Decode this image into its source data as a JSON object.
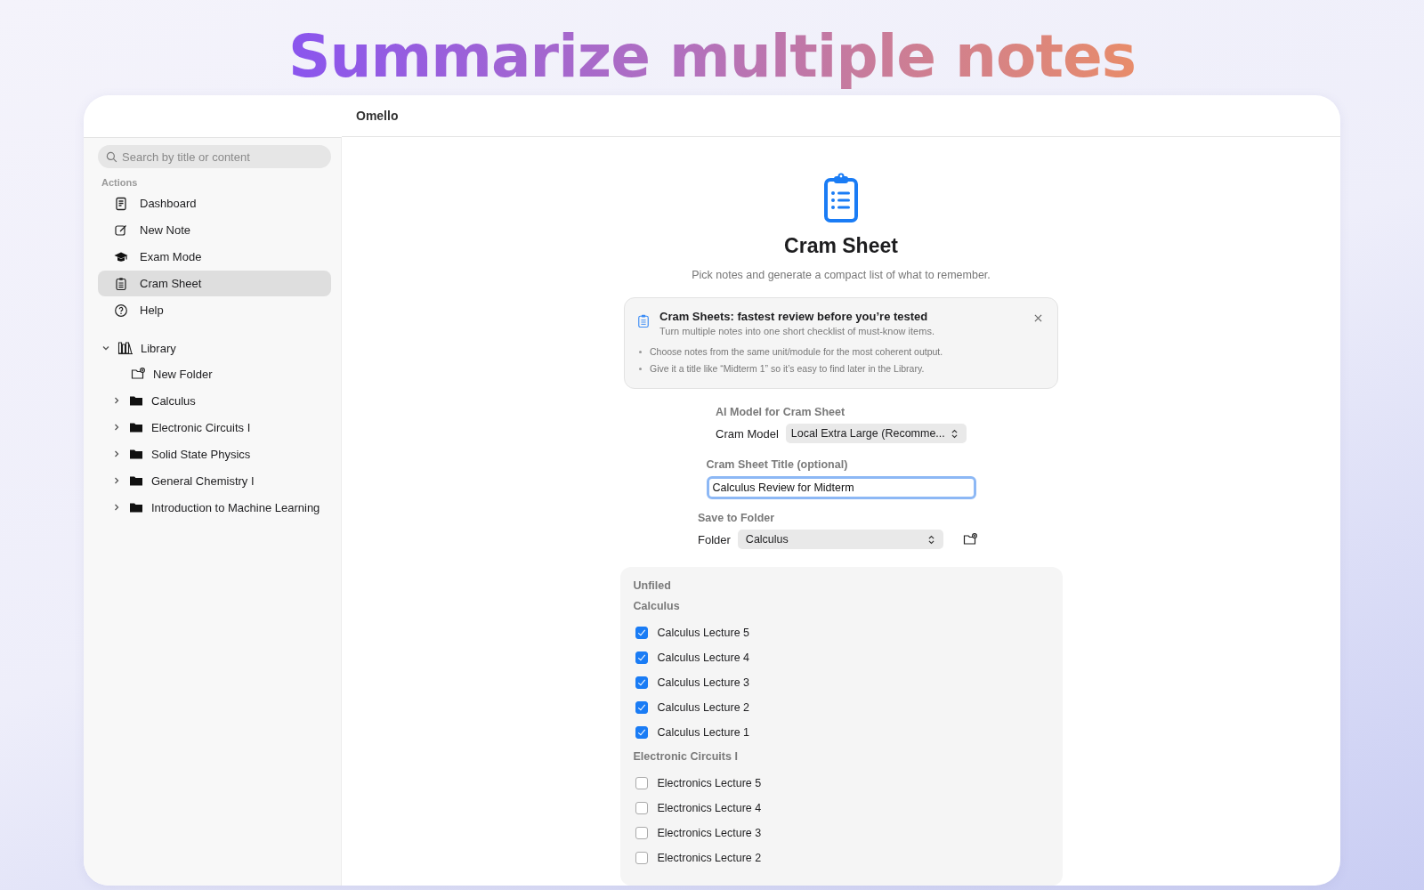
{
  "headline": "Summarize multiple notes",
  "sidebar": {
    "search": {
      "placeholder": "Search by title or content"
    },
    "section_label": "Actions",
    "actions": [
      {
        "label": "Dashboard",
        "kind": "dashboard",
        "selected": false
      },
      {
        "label": "New Note",
        "kind": "compose",
        "selected": false
      },
      {
        "label": "Exam Mode",
        "kind": "exam",
        "selected": false
      },
      {
        "label": "Cram Sheet",
        "kind": "clipboard",
        "selected": true
      },
      {
        "label": "Help",
        "kind": "help",
        "selected": false
      }
    ],
    "library": {
      "label": "Library",
      "expanded": true,
      "children": [
        {
          "label": "New Folder",
          "kind": "new-folder"
        },
        {
          "label": "Calculus",
          "kind": "folder",
          "expanded": false
        },
        {
          "label": "Electronic Circuits I",
          "kind": "folder",
          "expanded": false
        },
        {
          "label": "Solid State Physics",
          "kind": "folder",
          "expanded": false
        },
        {
          "label": "General Chemistry I",
          "kind": "folder",
          "expanded": false
        },
        {
          "label": "Introduction to Machine Learning",
          "kind": "folder",
          "expanded": false
        }
      ]
    }
  },
  "main": {
    "title": "Omello",
    "heading": "Cram Sheet",
    "subtitle": "Pick notes and generate a compact list of what to remember.",
    "tip": {
      "title": "Cram Sheets: fastest review before you’re tested",
      "subtitle": "Turn multiple notes into one short checklist of must-know items.",
      "bullets": [
        "Choose notes from the same unit/module for the most coherent output.",
        "Give it a title like “Midterm 1” so it’s easy to find later in the Library."
      ]
    },
    "model": {
      "heading": "AI Model for Cram Sheet",
      "label": "Cram Model",
      "value": "Local Extra Large (Recomme..."
    },
    "title_field": {
      "label": "Cram Sheet Title (optional)",
      "value": "Calculus Review for Midterm",
      "focused": true
    },
    "folder": {
      "heading": "Save to Folder",
      "label": "Folder",
      "value": "Calculus"
    },
    "notes": {
      "groups": [
        {
          "heading": "Unfiled"
        },
        {
          "heading": "Calculus",
          "items": [
            {
              "label": "Calculus Lecture 5",
              "checked": true
            },
            {
              "label": "Calculus Lecture 4",
              "checked": true
            },
            {
              "label": "Calculus Lecture 3",
              "checked": true
            },
            {
              "label": "Calculus Lecture 2",
              "checked": true
            },
            {
              "label": "Calculus Lecture 1",
              "checked": true
            }
          ]
        },
        {
          "heading": "Electronic Circuits I",
          "items": [
            {
              "label": "Electronics Lecture 5",
              "checked": false
            },
            {
              "label": "Electronics Lecture 4",
              "checked": false
            },
            {
              "label": "Electronics Lecture 3",
              "checked": false
            },
            {
              "label": "Electronics Lecture 2",
              "checked": false
            }
          ]
        }
      ]
    }
  }
}
